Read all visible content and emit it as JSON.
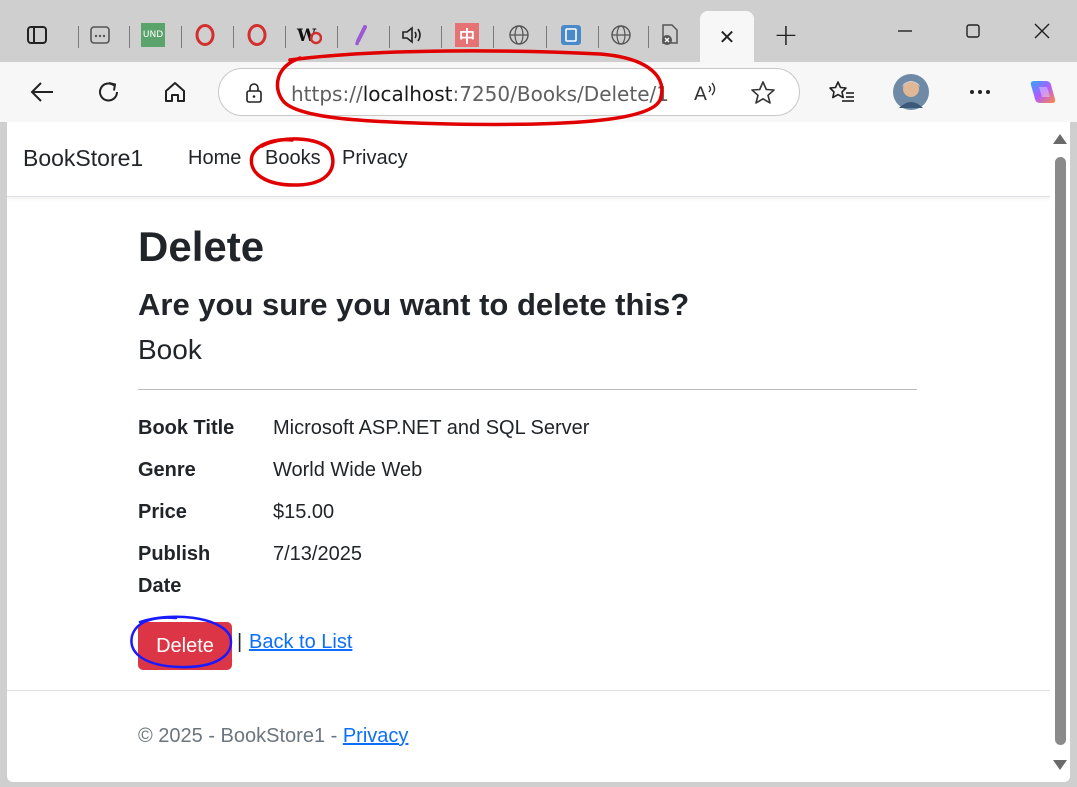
{
  "browser": {
    "tabs": [
      {
        "icon": "generic-page-icon"
      },
      {
        "icon": "und-icon",
        "label": "UND"
      },
      {
        "icon": "opera-icon"
      },
      {
        "icon": "opera-icon"
      },
      {
        "icon": "w-logo-icon"
      },
      {
        "icon": "slash-icon"
      },
      {
        "icon": "speaker-icon"
      },
      {
        "icon": "chinese-char-icon",
        "label": "中"
      },
      {
        "icon": "globe-icon"
      },
      {
        "icon": "document-icon"
      },
      {
        "icon": "globe-icon"
      },
      {
        "icon": "closed-page-icon"
      }
    ],
    "active_tab": {
      "close_glyph": "✕"
    },
    "new_tab_glyph": "+",
    "window_controls": {
      "minimize": "—",
      "maximize": "☐",
      "close": "✕"
    },
    "url": {
      "scheme": "https://",
      "host": "localhost",
      "rest": ":7250/Books/Delete/1"
    },
    "read_aloud_label": "A"
  },
  "navbar": {
    "brand": "BookStore1",
    "links": [
      "Home",
      "Books",
      "Privacy"
    ]
  },
  "page": {
    "title": "Delete",
    "question": "Are you sure you want to delete this?",
    "entity": "Book",
    "fields": [
      {
        "label": "Book Title",
        "value": "Microsoft ASP.NET and SQL Server"
      },
      {
        "label": "Genre",
        "value": "World Wide Web"
      },
      {
        "label": "Price",
        "value": "$15.00"
      },
      {
        "label": "Publish Date",
        "value": "7/13/2025"
      }
    ],
    "delete_label": "Delete",
    "separator": "|",
    "back_label": "Back to List"
  },
  "footer": {
    "text": "© 2025 - BookStore1 - ",
    "privacy_label": "Privacy"
  },
  "colors": {
    "danger": "#dc3545",
    "link": "#0d6efd",
    "annotation_red": "#e00000",
    "annotation_blue": "#1a1aff"
  }
}
